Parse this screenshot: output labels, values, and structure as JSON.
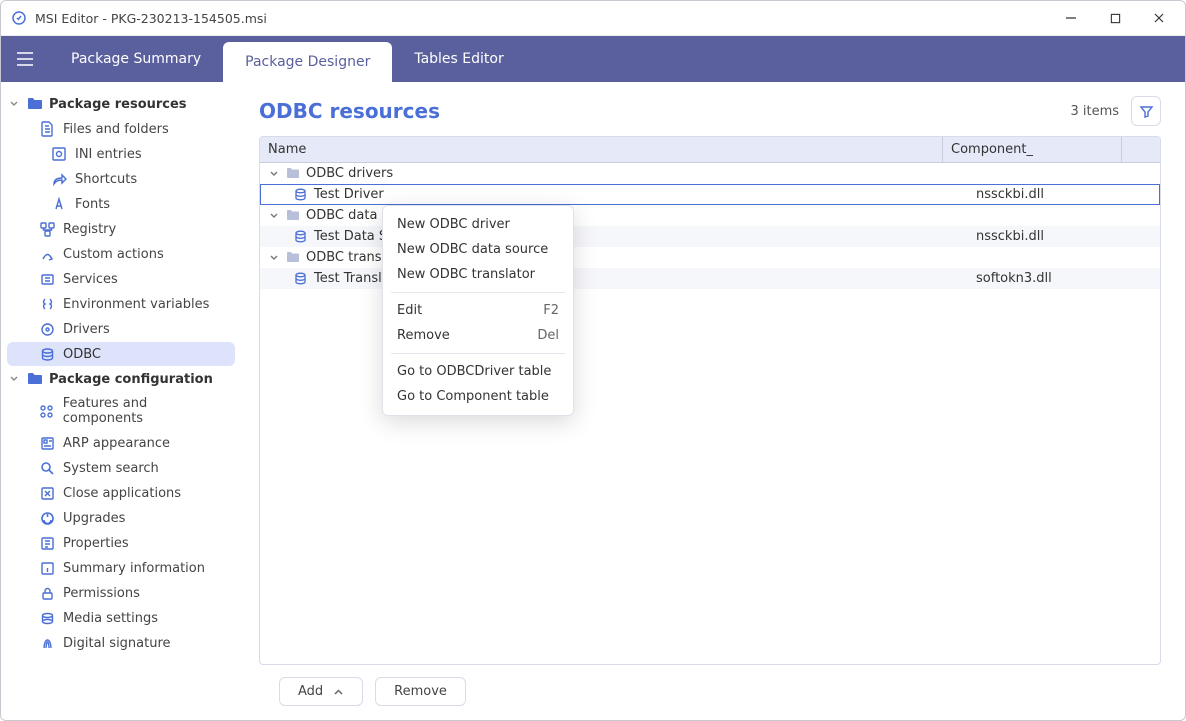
{
  "titlebar": {
    "appName": "MSI Editor",
    "filename": "PKG-230213-154505.msi"
  },
  "tabs": {
    "summary": "Package Summary",
    "designer": "Package Designer",
    "tables": "Tables Editor"
  },
  "sidebar": {
    "group_resources": "Package resources",
    "items_resources": [
      {
        "label": "Files and folders"
      },
      {
        "label": "INI entries"
      },
      {
        "label": "Shortcuts"
      },
      {
        "label": "Fonts"
      },
      {
        "label": "Registry"
      },
      {
        "label": "Custom actions"
      },
      {
        "label": "Services"
      },
      {
        "label": "Environment variables"
      },
      {
        "label": "Drivers"
      },
      {
        "label": "ODBC"
      }
    ],
    "group_config": "Package configuration",
    "items_config": [
      {
        "label": "Features and components"
      },
      {
        "label": "ARP appearance"
      },
      {
        "label": "System search"
      },
      {
        "label": "Close applications"
      },
      {
        "label": "Upgrades"
      },
      {
        "label": "Properties"
      },
      {
        "label": "Summary information"
      },
      {
        "label": "Permissions"
      },
      {
        "label": "Media settings"
      },
      {
        "label": "Digital signature"
      }
    ]
  },
  "main": {
    "title": "ODBC resources",
    "items_count": "3 items",
    "columns": {
      "name": "Name",
      "component": "Component_"
    },
    "rows": [
      {
        "type": "group",
        "label": "ODBC drivers"
      },
      {
        "type": "item",
        "label": "Test Driver",
        "component": "nssckbi.dll",
        "selected": true
      },
      {
        "type": "group",
        "label": "ODBC data so"
      },
      {
        "type": "item",
        "label": "Test Data So",
        "component": "nssckbi.dll"
      },
      {
        "type": "group",
        "label": "ODBC translat"
      },
      {
        "type": "item",
        "label": "Test Translat",
        "component": "softokn3.dll"
      }
    ]
  },
  "footer": {
    "add": "Add",
    "remove": "Remove"
  },
  "ctx": {
    "new_driver": "New ODBC driver",
    "new_ds": "New ODBC data source",
    "new_tr": "New ODBC translator",
    "edit": "Edit",
    "edit_sc": "F2",
    "remove": "Remove",
    "remove_sc": "Del",
    "goto_driver": "Go to ODBCDriver table",
    "goto_comp": "Go to Component table"
  }
}
